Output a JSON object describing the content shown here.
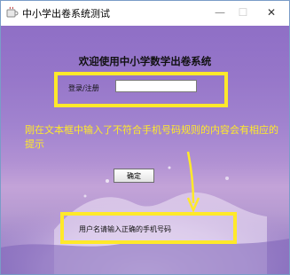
{
  "window": {
    "title": "中小学出卷系统测试",
    "controls": {
      "minimize": "—",
      "maximize": "☐",
      "close": "✕"
    }
  },
  "main": {
    "heading": "欢迎使用中小学数学出卷系统",
    "login_label": "登录/注册",
    "login_input_value": "",
    "confirm_label": "确定",
    "message": "用户名请输入正确的手机号码"
  },
  "annotation": {
    "text": "刚在文本框中输入了不符合手机号码规则的内容会有相应的提示"
  },
  "colors": {
    "highlight": "#ffe92a",
    "background_top": "#8f6fc6"
  }
}
